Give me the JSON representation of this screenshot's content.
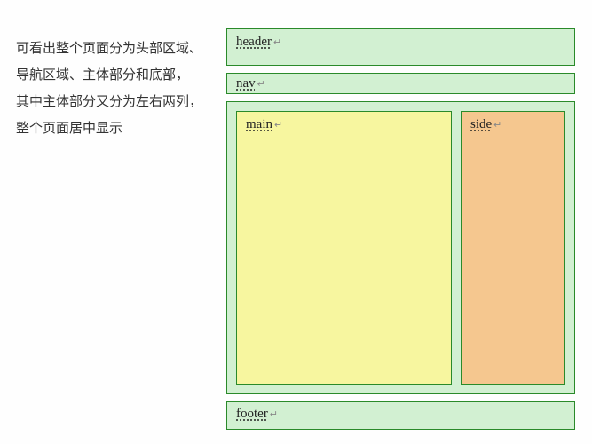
{
  "description": {
    "line1": "可看出整个页面分为头部区域、",
    "line2": "导航区域、主体部分和底部，",
    "line3": "其中主体部分又分为左右两列，",
    "line4": "整个页面居中显示"
  },
  "layout": {
    "header": "header",
    "nav": "nav",
    "main": "main",
    "side": "side",
    "footer": "footer"
  },
  "cr_mark": "↵"
}
